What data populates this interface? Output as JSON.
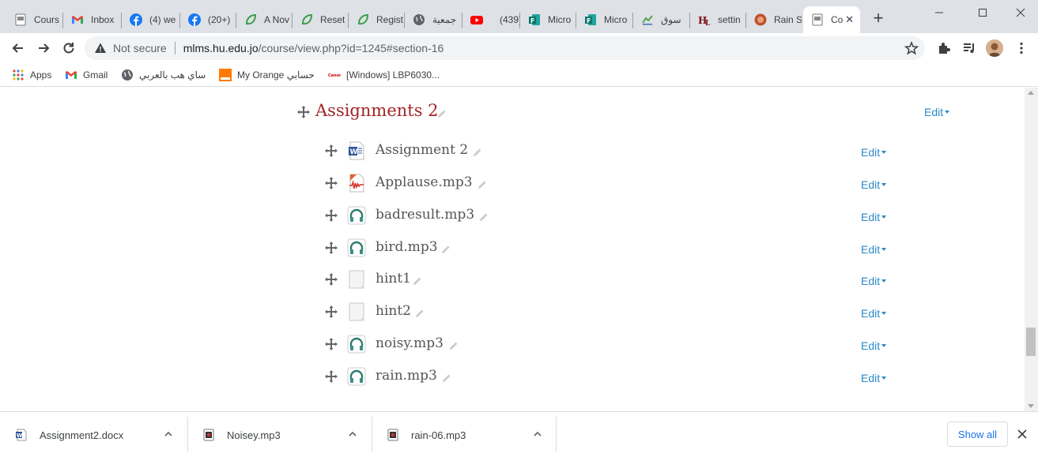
{
  "browser": {
    "tabs": [
      {
        "title": "Cours",
        "icon": "page-icon"
      },
      {
        "title": "Inbox",
        "icon": "gmail-icon"
      },
      {
        "title": "(4) we",
        "icon": "facebook-icon"
      },
      {
        "title": "(20+)",
        "icon": "facebook-icon"
      },
      {
        "title": "A Nov",
        "icon": "leaf-icon"
      },
      {
        "title": "Reset",
        "icon": "leaf-icon"
      },
      {
        "title": "Regist",
        "icon": "leaf-icon"
      },
      {
        "title": "جمعية",
        "icon": "globe-icon"
      },
      {
        "title": "(439)",
        "icon": "youtube-icon"
      },
      {
        "title": "Micro",
        "icon": "forms-icon"
      },
      {
        "title": "Micro",
        "icon": "forms-icon"
      },
      {
        "title": "سوق",
        "icon": "market-icon"
      },
      {
        "title": "settin",
        "icon": "hl-icon"
      },
      {
        "title": "Rain S",
        "icon": "rain-icon"
      },
      {
        "title": "Co",
        "icon": "page-icon"
      }
    ],
    "new_tab_label": "+",
    "address": {
      "security_label": "Not secure",
      "host": "mlms.hu.edu.jo",
      "path": "/course/view.php?id=1245#section-16"
    },
    "bookmarks": [
      {
        "label": "Apps",
        "icon": "apps-grid-icon"
      },
      {
        "label": "Gmail",
        "icon": "gmail-icon"
      },
      {
        "label": "ساي هب بالعربي",
        "icon": "globe-icon"
      },
      {
        "label": "My Orange حسابي",
        "icon": "orange-icon"
      },
      {
        "label": "[Windows] LBP6030...",
        "icon": "canon-icon"
      }
    ]
  },
  "section": {
    "title": "Assignments 2",
    "edit_label": "Edit"
  },
  "activities": [
    {
      "name": "Assignment 2",
      "icon": "word-document-icon",
      "edit_label": "Edit"
    },
    {
      "name": "Applause.mp3",
      "icon": "audio-file-icon",
      "edit_label": "Edit"
    },
    {
      "name": "badresult.mp3",
      "icon": "headphones-icon",
      "edit_label": "Edit"
    },
    {
      "name": "bird.mp3",
      "icon": "headphones-icon",
      "edit_label": "Edit"
    },
    {
      "name": "hint1",
      "icon": "blank-file-icon",
      "edit_label": "Edit"
    },
    {
      "name": "hint2",
      "icon": "blank-file-icon",
      "edit_label": "Edit"
    },
    {
      "name": "noisy.mp3",
      "icon": "headphones-icon",
      "edit_label": "Edit"
    },
    {
      "name": "rain.mp3",
      "icon": "headphones-icon",
      "edit_label": "Edit"
    }
  ],
  "downloads": {
    "items": [
      {
        "filename": "Assignment2.docx",
        "icon": "word-document-icon"
      },
      {
        "filename": "Noisey.mp3",
        "icon": "audio-file-icon"
      },
      {
        "filename": "rain-06.mp3",
        "icon": "audio-file-icon"
      }
    ],
    "show_all_label": "Show all"
  },
  "colors": {
    "section_title": "#a32327",
    "edit_link": "#2a8ac7",
    "activity_text": "#555555",
    "tab_strip": "#dee1e6"
  }
}
